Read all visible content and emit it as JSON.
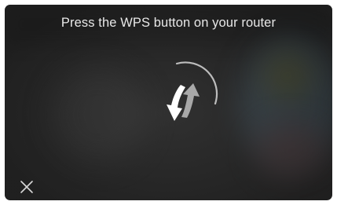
{
  "dialog": {
    "message": "Press the WPS button on your router"
  },
  "icons": {
    "spinner": "wps-sync-icon",
    "close": "close-icon"
  },
  "colors": {
    "text": "#e8e8e8",
    "arrow_primary": "#ffffff",
    "arrow_secondary": "#a8a8a8",
    "progress_arc": "#bdbdbd"
  }
}
